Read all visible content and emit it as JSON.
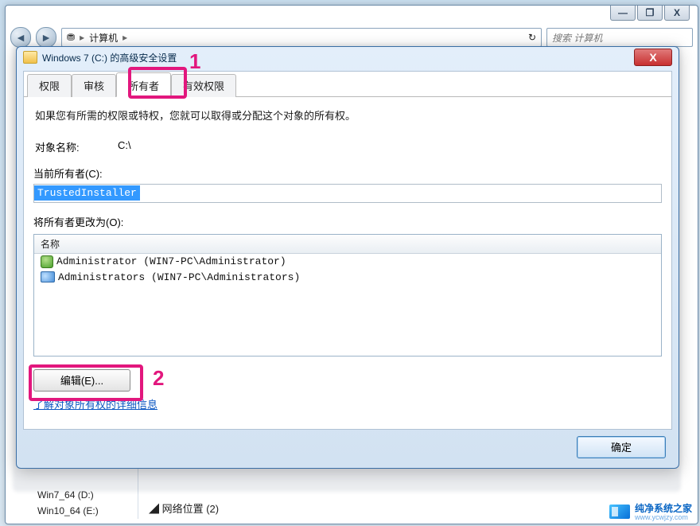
{
  "os_window": {
    "min_label": "—",
    "max_label": "❐",
    "close_label": "X"
  },
  "explorer": {
    "nav_back": "◄",
    "nav_fwd": "►",
    "computer_icon": "⛃",
    "address_item": "计算机",
    "address_sep": "▸",
    "search_placeholder": "搜索 计算机",
    "refresh_icon": "↻",
    "tree": {
      "item1": "Win7_64 (D:)",
      "item2": "Win10_64 (E:)",
      "netloc_prefix": "◢ 网络位置 (2)"
    }
  },
  "dialog": {
    "title": "Windows 7 (C:) 的高级安全设置",
    "close_label": "X",
    "tabs": {
      "perm": "权限",
      "audit": "审核",
      "owner": "所有者",
      "effective": "有效权限"
    },
    "intro": "如果您有所需的权限或特权，您就可以取得或分配这个对象的所有权。",
    "object_label": "对象名称:",
    "object_value": "C:\\",
    "current_owner_label": "当前所有者(C):",
    "current_owner_value": "TrustedInstaller",
    "change_owner_label": "将所有者更改为(O):",
    "list_header": "名称",
    "entries": [
      {
        "type": "user",
        "text": "Administrator (WIN7-PC\\Administrator)"
      },
      {
        "type": "group",
        "text": "Administrators (WIN7-PC\\Administrators)"
      }
    ],
    "edit_button": "编辑(E)...",
    "learn_link": "了解对象所有权的详细信息",
    "ok_button": "确定"
  },
  "annotations": {
    "one": "1",
    "two": "2"
  },
  "watermark": {
    "name": "纯净系统之家",
    "url": "www.ycwjzy.com"
  }
}
